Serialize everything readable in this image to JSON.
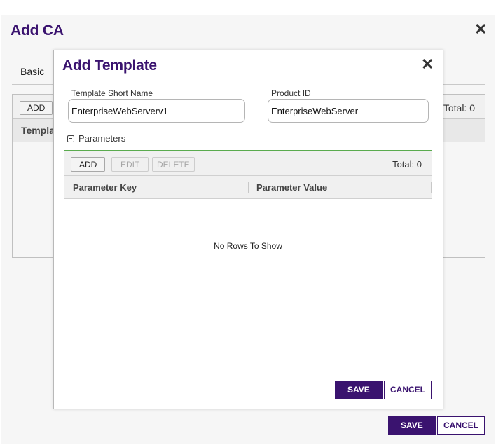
{
  "outer_dialog": {
    "title": "Add CA",
    "tab_basic": "Basic",
    "grid": {
      "add_label": "ADD",
      "total_label": "Total: 0",
      "header_col": "Templat"
    },
    "save_label": "SAVE",
    "cancel_label": "CANCEL"
  },
  "inner_dialog": {
    "title": "Add Template",
    "template_short_name_label": "Template Short Name",
    "template_short_name_value": "EnterpriseWebServerv1",
    "product_id_label": "Product ID",
    "product_id_value": "EnterpriseWebServer",
    "parameters_section_label": "Parameters",
    "parameters_grid": {
      "add_label": "ADD",
      "edit_label": "EDIT",
      "delete_label": "DELETE",
      "total_label": "Total: 0",
      "columns": [
        "Parameter Key",
        "Parameter Value"
      ],
      "empty_message": "No Rows To Show"
    },
    "save_label": "SAVE",
    "cancel_label": "CANCEL"
  },
  "icons": {
    "close": "close-icon",
    "collapse": "minus-square-icon"
  },
  "colors": {
    "brand": "#3a136f",
    "section_divider": "#5aab4e"
  }
}
